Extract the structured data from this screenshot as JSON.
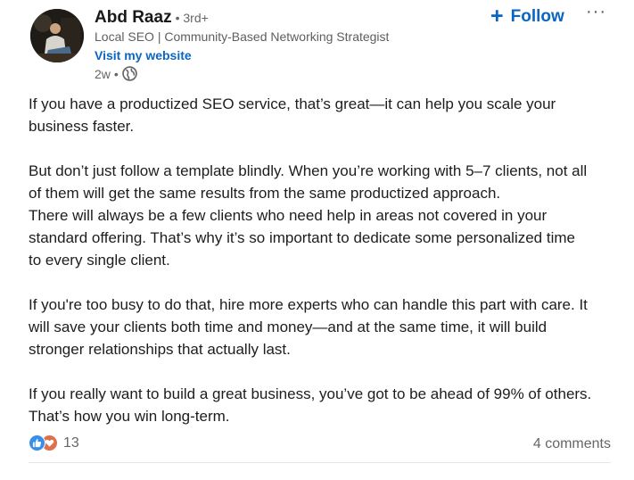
{
  "author": {
    "name": "Abd Raaz",
    "degree": "• 3rd+",
    "headline": "Local SEO | Community-Based Networking Strategist",
    "website_link": "Visit my website",
    "time": "2w",
    "time_sep": "•",
    "visibility_icon": "globe-icon"
  },
  "actions": {
    "follow_icon": "+",
    "follow_label": "Follow",
    "more_label": "···"
  },
  "post": {
    "paragraphs": [
      [
        "If you have a productized SEO service, that’s great—it can help you scale your",
        "business faster."
      ],
      [
        "But don’t just follow a template blindly. When you’re working with 5–7 clients, not all",
        "of them will get the same results from the same productized approach.",
        "There will always be a few clients who need help in areas not covered in your",
        "standard offering. That’s why it’s so important to dedicate some personalized time",
        "to every single client."
      ],
      [
        "If you're too busy to do that, hire more experts who can handle this part with care. It",
        "will save your clients both time and money—and at the same time, it will build",
        "stronger relationships that actually last."
      ],
      [
        "If you really want to build a great business, you’ve got to be ahead of 99% of others.",
        "That’s how you win long-term."
      ]
    ]
  },
  "social": {
    "reaction_icons": [
      "like-icon",
      "love-icon"
    ],
    "reaction_count": "13",
    "comments": "4 comments"
  },
  "colors": {
    "accent": "#0a66c2",
    "like": "#378fe9",
    "love": "#df704d"
  }
}
